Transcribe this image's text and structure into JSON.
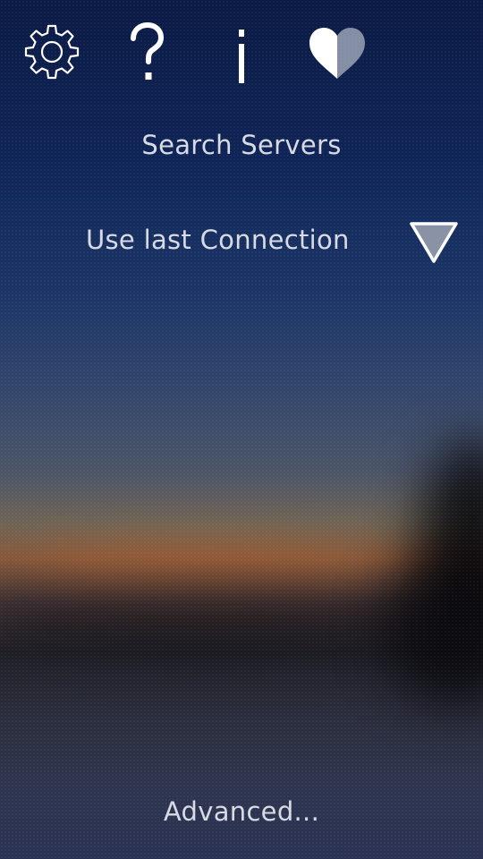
{
  "toolbar": {
    "icons": [
      {
        "name": "settings",
        "icon": "gear-icon"
      },
      {
        "name": "help",
        "icon": "question-mark-icon",
        "glyph": "?"
      },
      {
        "name": "info",
        "icon": "info-icon",
        "glyph": "i"
      },
      {
        "name": "favorite",
        "icon": "heart-icon"
      }
    ]
  },
  "menu": {
    "search_servers": "Search Servers",
    "use_last_connection": "Use last Connection",
    "dropdown_icon": "triangle-down-icon",
    "advanced": "Advanced..."
  },
  "colors": {
    "text": "#d8dbe4",
    "icon": "#ffffff",
    "dropdown_fill": "#8a93a6"
  }
}
